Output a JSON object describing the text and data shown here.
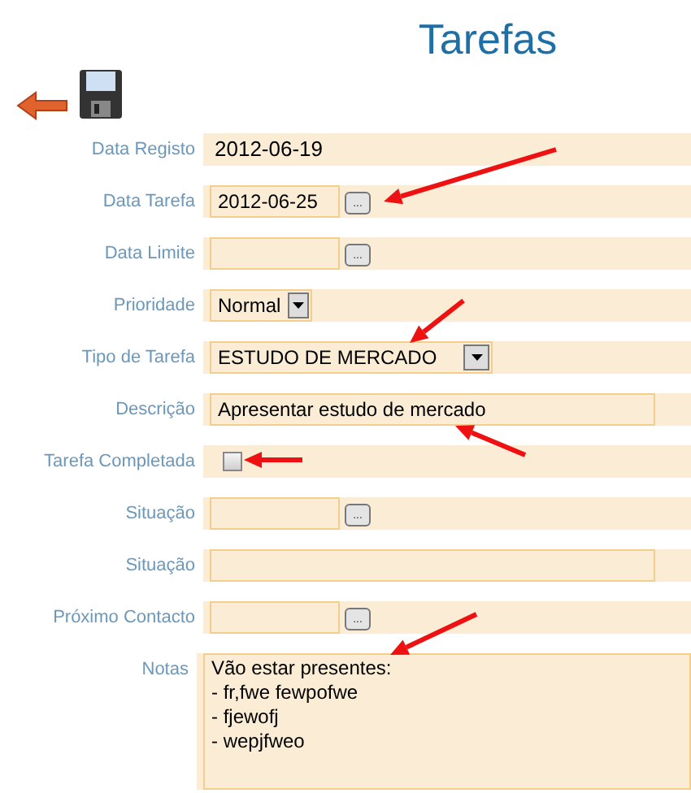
{
  "title": "Tarefas",
  "fields": [
    {
      "kind": "text",
      "label": "Data Registo",
      "value": "2012-06-19"
    },
    {
      "kind": "date",
      "label": "Data Tarefa",
      "value": "2012-06-25",
      "picker_label": "..."
    },
    {
      "kind": "date",
      "label": "Data Limite",
      "picker_label": "..."
    },
    {
      "kind": "select",
      "label": "Prioridade",
      "value": "Normal"
    },
    {
      "kind": "wide-select",
      "label": "Tipo de Tarefa",
      "value": "ESTUDO DE MERCADO"
    },
    {
      "kind": "input",
      "label": "Descrição",
      "value": "Apresentar estudo de mercado"
    },
    {
      "kind": "checkbox",
      "label": "Tarefa Completada",
      "checked": false
    },
    {
      "kind": "date",
      "label": "Situação",
      "picker_label": "..."
    },
    {
      "kind": "input",
      "label": "Situação"
    },
    {
      "kind": "date",
      "label": "Próximo Contacto",
      "picker_label": "..."
    },
    {
      "kind": "textarea",
      "label": "Notas",
      "value": "Vão estar presentes:\n- fr,fwe fewpofwe\n- fjewofj\n- wepjfweo"
    }
  ]
}
